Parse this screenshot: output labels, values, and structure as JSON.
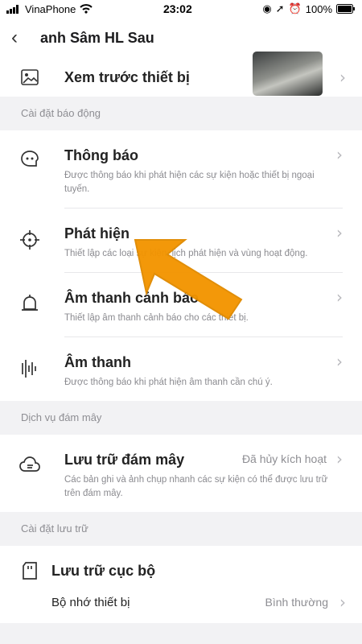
{
  "status": {
    "carrier": "VinaPhone",
    "time": "23:02",
    "battery": "100%"
  },
  "nav": {
    "title": "anh Sâm HL Sau"
  },
  "preview": {
    "label": "Xem trước thiết bị"
  },
  "sections": {
    "alarm": "Cài đặt báo động",
    "cloud": "Dịch vụ đám mây",
    "storage": "Cài đặt lưu trữ"
  },
  "alarm_items": [
    {
      "title": "Thông báo",
      "desc": "Được thông báo khi phát hiện các sự kiện hoặc thiết bị ngoại tuyến."
    },
    {
      "title": "Phát hiện",
      "desc": "Thiết lập các loại sự kiện, lịch phát hiện và vùng hoạt động."
    },
    {
      "title": "Âm thanh cảnh báo",
      "desc": "Thiết lập âm thanh cảnh báo cho các thiết bị."
    },
    {
      "title": "Âm thanh",
      "desc": "Được thông báo khi phát hiện âm thanh cần chú ý."
    }
  ],
  "cloud": {
    "title": "Lưu trữ đám mây",
    "value": "Đã hủy kích hoạt",
    "desc": "Các bản ghi và ảnh chụp nhanh các sự kiện có thể được lưu trữ trên đám mây."
  },
  "storage": {
    "title": "Lưu trữ cục bộ",
    "device_memory": "Bộ nhớ thiết bị",
    "device_memory_value": "Bình thường"
  },
  "colors": {
    "arrow": "#f39400"
  }
}
